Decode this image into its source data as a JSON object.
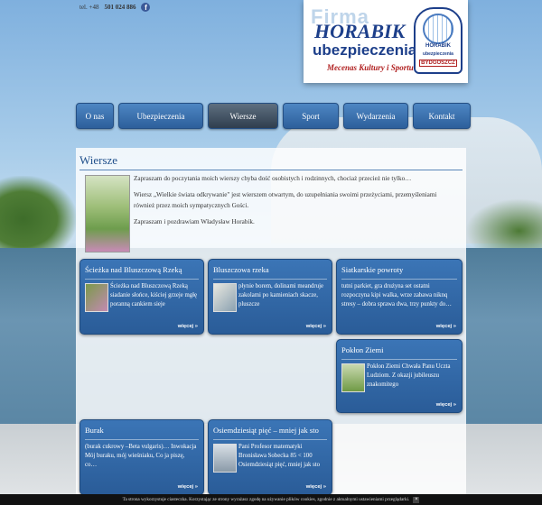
{
  "header": {
    "phone_prefix": "tel. +48",
    "phone_number": "501 024 886",
    "facebook_icon_glyph": "f"
  },
  "logo": {
    "firma": "Firma",
    "brand": "HORABIK",
    "ubezpieczenia": "ubezpieczenia",
    "tagline": "Mecenas Kultury i Sportu",
    "badge_line1": "HORABIK",
    "badge_line2": "ubezpieczenia",
    "badge_city": "BYDGOSZCZ"
  },
  "nav": {
    "items": [
      {
        "label": "O nas"
      },
      {
        "label": "Ubezpieczenia"
      },
      {
        "label": "Wiersze"
      },
      {
        "label": "Sport"
      },
      {
        "label": "Wydarzenia"
      },
      {
        "label": "Kontakt"
      }
    ]
  },
  "page": {
    "title": "Wiersze",
    "intro": [
      "Zapraszam do poczytania moich wierszy chyba dość osobistych i rodzinnych, chociaż przecież nie tylko…",
      "Wiersz „Wielkie świata odkrywanie\" jest wierszem otwartym, do uzupełniania swoimi przeżyciami, przemyśleniami również przez moich sympatycznych Gości.",
      "Zapraszam i pozdrawiam Władysław Horabik."
    ]
  },
  "cards": [
    {
      "title": "Ścieżka nad Bluszczową Rzeką",
      "text": "Ścieżka nad Bluszczową Rzeką siadanie słońce, kiściej grzeje mgłę poranną cankiem sieje",
      "more": "więcej »"
    },
    {
      "title": "Bluszczowa rzeka",
      "text": "płynie borem, dolinami meandruje zakolami po kamieniach skacze, pluszcze",
      "more": "więcej »"
    },
    {
      "title": "Siatkarskie powroty",
      "text": "tutni parkiet, gra drużyna set ostatni rozpoczyna kipi walka, wrze zabawa niknq stresy – dobra sprawa dwa, trzy punkty do…",
      "more": "więcej »"
    },
    {
      "title": "Pokłon Ziemi",
      "text": "Pokłon Ziemi Chwała Panu Uczta Ludziom. Z okazji jubileuszu znakomitego",
      "more": "więcej »"
    },
    {
      "title": "Burak",
      "text": "(burak cukrowy –Beta vulgaris)… Inwokacja   Mój buraku, mój wieśniaku, Co ja piszę, co…",
      "more": "więcej »"
    },
    {
      "title": "Osiemdziesiąt pięć – mniej jak sto",
      "text": "Pani Profesor matematyki Bronisława Sobecka 85 < 100 Osiemdziesiąt pięć, mniej jak sto",
      "more": "więcej »"
    }
  ],
  "cookie": {
    "text": "Ta strona wykorzystuje ciasteczka. Korzystając ze strony wyrażasz zgodę na używanie plików cookies, zgodnie z aktualnymi ustawieniami przeglądarki.",
    "close": "×"
  }
}
